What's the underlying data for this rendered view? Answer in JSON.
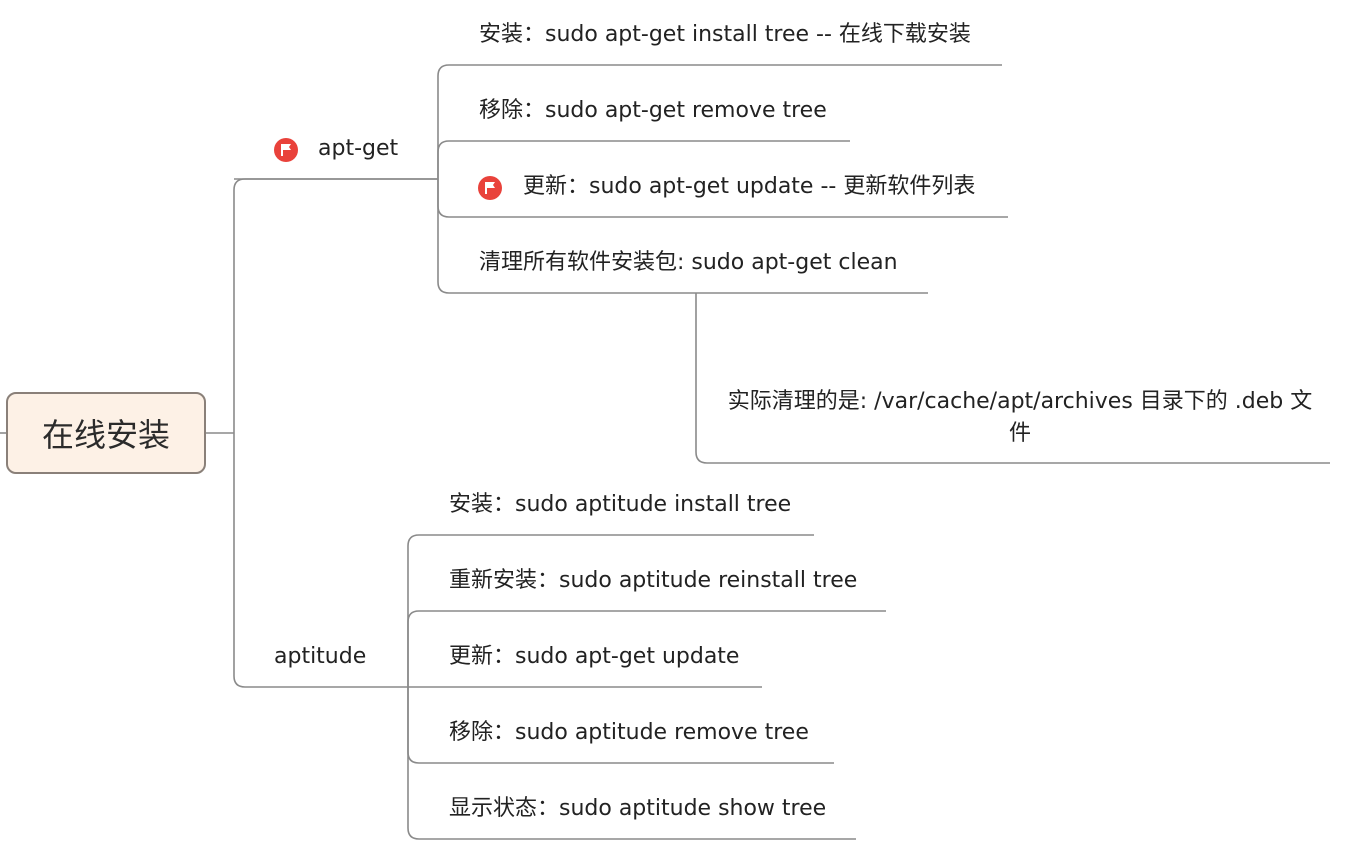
{
  "root": {
    "label": "在线安装"
  },
  "branches": {
    "apt_get": {
      "label": "apt-get",
      "flag_icon": "red-flag-icon",
      "items": [
        {
          "label": "安装：sudo apt-get install tree -- 在线下载安装"
        },
        {
          "label": "移除：sudo apt-get remove tree"
        },
        {
          "label": "更新：sudo apt-get update -- 更新软件列表",
          "flag_icon": "red-flag-icon"
        },
        {
          "label": "清理所有软件安装包: sudo apt-get clean"
        }
      ],
      "clean_note": {
        "label": "实际清理的是: /var/cache/apt/archives 目录下的 .deb 文件"
      }
    },
    "aptitude": {
      "label": "aptitude",
      "items": [
        {
          "label": "安装：sudo aptitude install tree"
        },
        {
          "label": "重新安装：sudo aptitude reinstall tree"
        },
        {
          "label": "更新：sudo apt-get update"
        },
        {
          "label": "移除：sudo aptitude remove tree"
        },
        {
          "label": "显示状态：sudo aptitude show tree"
        }
      ]
    }
  },
  "colors": {
    "line": "#8a8a8a",
    "root_fill": "#fdf1e6",
    "root_border": "#8a8079",
    "flag": "#e9423b"
  }
}
